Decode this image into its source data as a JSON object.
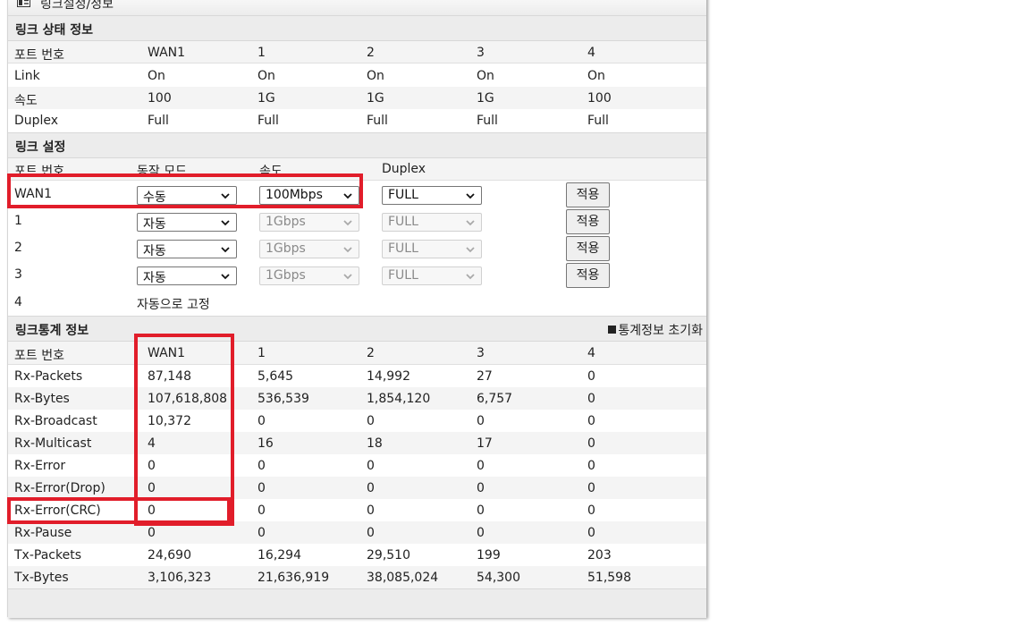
{
  "window": {
    "title": "링크설정/정보"
  },
  "status_section": {
    "title": "링크 상태 정보",
    "header": [
      "포트 번호",
      "WAN1",
      "1",
      "2",
      "3",
      "4"
    ],
    "rows": [
      [
        "Link",
        "On",
        "On",
        "On",
        "On",
        "On"
      ],
      [
        "속도",
        "100",
        "1G",
        "1G",
        "1G",
        "100"
      ],
      [
        "Duplex",
        "Full",
        "Full",
        "Full",
        "Full",
        "Full"
      ]
    ]
  },
  "settings_section": {
    "title": "링크 설정",
    "header": [
      "포트 번호",
      "동작 모드",
      "속도",
      "Duplex"
    ],
    "rows": [
      {
        "port": "WAN1",
        "mode": "수동",
        "speed": "100Mbps",
        "duplex": "FULL",
        "apply": "적용"
      },
      {
        "port": "1",
        "mode": "자동",
        "speed": "1Gbps",
        "duplex": "FULL",
        "apply": "적용"
      },
      {
        "port": "2",
        "mode": "자동",
        "speed": "1Gbps",
        "duplex": "FULL",
        "apply": "적용"
      },
      {
        "port": "3",
        "mode": "자동",
        "speed": "1Gbps",
        "duplex": "FULL",
        "apply": "적용"
      }
    ],
    "fixed_row": {
      "port": "4",
      "note": "자동으로 고정"
    }
  },
  "stats_section": {
    "title": "링크통계 정보",
    "reset_label": "통계정보 초기화",
    "header": [
      "포트 번호",
      "WAN1",
      "1",
      "2",
      "3",
      "4"
    ],
    "rows": [
      [
        "Rx-Packets",
        "87,148",
        "5,645",
        "14,992",
        "27",
        "0"
      ],
      [
        "Rx-Bytes",
        "107,618,808",
        "536,539",
        "1,854,120",
        "6,757",
        "0"
      ],
      [
        "Rx-Broadcast",
        "10,372",
        "0",
        "0",
        "0",
        "0"
      ],
      [
        "Rx-Multicast",
        "4",
        "16",
        "18",
        "17",
        "0"
      ],
      [
        "Rx-Error",
        "0",
        "0",
        "0",
        "0",
        "0"
      ],
      [
        "Rx-Error(Drop)",
        "0",
        "0",
        "0",
        "0",
        "0"
      ],
      [
        "Rx-Error(CRC)",
        "0",
        "0",
        "0",
        "0",
        "0"
      ],
      [
        "Rx-Pause",
        "0",
        "0",
        "0",
        "0",
        "0"
      ],
      [
        "Tx-Packets",
        "24,690",
        "16,294",
        "29,510",
        "199",
        "203"
      ],
      [
        "Tx-Bytes",
        "3,106,323",
        "21,636,919",
        "38,085,024",
        "54,300",
        "51,598"
      ]
    ]
  },
  "colors": {
    "highlight": "#e11d2a",
    "section_bg": "#ececec",
    "alt_row": "#f4f4f4"
  }
}
